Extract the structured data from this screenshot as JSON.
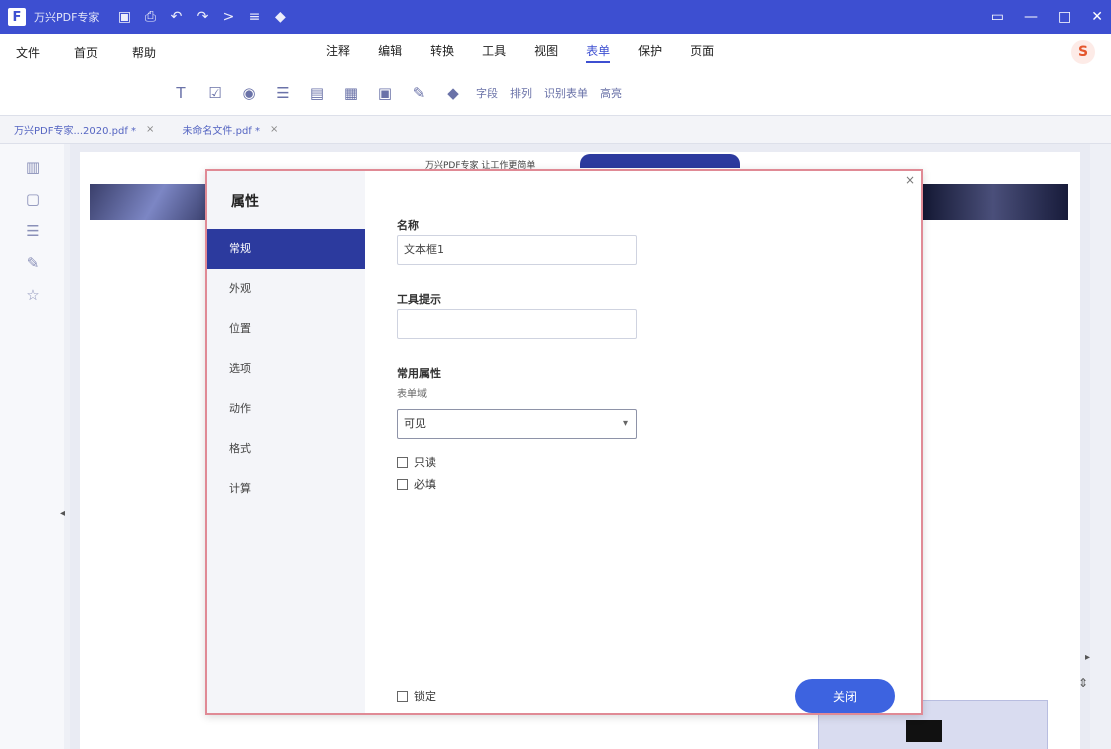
{
  "titlebar": {
    "logo": "F",
    "title": "万兴PDF专家",
    "quick_icons": [
      "save-icon",
      "print-icon",
      "undo-icon",
      "redo-icon",
      "share-icon",
      "menu-icon",
      "pin-icon"
    ],
    "window_controls": [
      "restore-icon",
      "minimize-icon",
      "maximize-icon",
      "close-icon"
    ]
  },
  "menubar": {
    "left": [
      "文件",
      "首页",
      "帮助"
    ],
    "center": [
      "注释",
      "编辑",
      "转换",
      "工具",
      "视图",
      "表单",
      "保护",
      "页面"
    ],
    "active": "表单",
    "avatar": "S"
  },
  "toolbar": {
    "tools": [
      "text-field-icon",
      "checkbox-icon",
      "radio-icon",
      "list-icon",
      "dropdown-icon",
      "button-icon",
      "image-field-icon",
      "signature-icon",
      "arrow-icon"
    ],
    "labels": [
      "字段",
      "排列",
      "识别表单",
      "高亮"
    ]
  },
  "doctabs": [
    {
      "label": "万兴PDF专家...2020.pdf *",
      "close": "×"
    },
    {
      "label": "未命名文件.pdf *",
      "close": "×"
    }
  ],
  "leftbar": {
    "icons": [
      "thumbnail-icon",
      "bookmark-icon",
      "layers-icon",
      "comment-icon",
      "attachment-icon"
    ]
  },
  "page": {
    "header_text": "万兴PDF专家 让工作更简单"
  },
  "dialog": {
    "title": "属性",
    "nav": [
      "常规",
      "外观",
      "位置",
      "选项",
      "动作",
      "格式",
      "计算"
    ],
    "active_nav": "常规",
    "name_label": "名称",
    "name_value": "文本框1",
    "tooltip_label": "工具提示",
    "tooltip_value": "",
    "common_label": "常用属性",
    "form_field_label": "表单域",
    "form_field_value": "可见",
    "readonly_label": "只读",
    "required_label": "必填",
    "locked_label": "锁定",
    "ok_label": "关闭",
    "close_icon": "×"
  }
}
